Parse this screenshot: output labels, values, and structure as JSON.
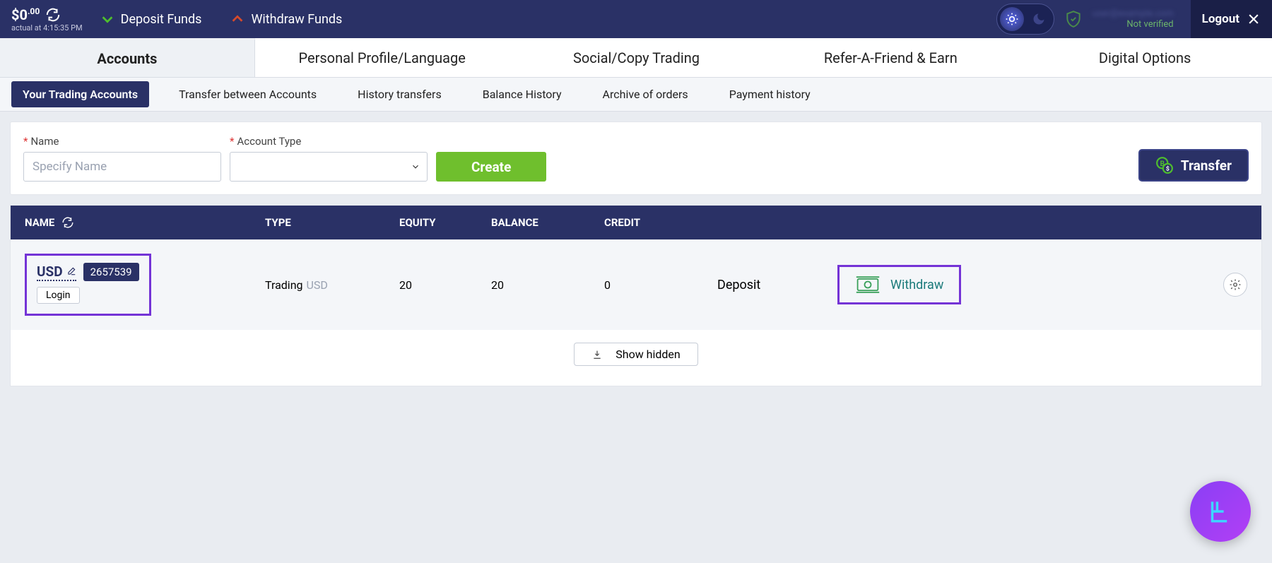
{
  "topbar": {
    "balance_main": "$0",
    "balance_cents": ".00",
    "actual_label": "actual at 4:15:35 PM",
    "deposit_label": "Deposit Funds",
    "withdraw_label": "Withdraw Funds",
    "verify_email": "user@example.com",
    "verify_status": "Not verified",
    "logout_label": "Logout"
  },
  "main_nav": {
    "accounts": "Accounts",
    "profile": "Personal Profile/Language",
    "social": "Social/Copy Trading",
    "refer": "Refer-A-Friend & Earn",
    "digital": "Digital Options"
  },
  "sub_nav": {
    "trading_accounts": "Your Trading Accounts",
    "transfer_between": "Transfer between Accounts",
    "history_transfers": "History transfers",
    "balance_history": "Balance History",
    "archive_orders": "Archive of orders",
    "payment_history": "Payment history"
  },
  "form": {
    "name_label": "Name",
    "name_placeholder": "Specify Name",
    "type_label": "Account Type",
    "create_label": "Create",
    "transfer_label": "Transfer"
  },
  "table": {
    "head": {
      "name": "NAME",
      "type": "TYPE",
      "equity": "EQUITY",
      "balance": "BALANCE",
      "credit": "CREDIT"
    },
    "row": {
      "currency": "USD",
      "account_id": "2657539",
      "login_label": "Login",
      "type_main": "Trading",
      "type_sub": "USD",
      "equity": "20",
      "balance": "20",
      "credit": "0",
      "deposit_label": "Deposit",
      "withdraw_label": "Withdraw"
    },
    "show_hidden_label": "Show hidden"
  }
}
